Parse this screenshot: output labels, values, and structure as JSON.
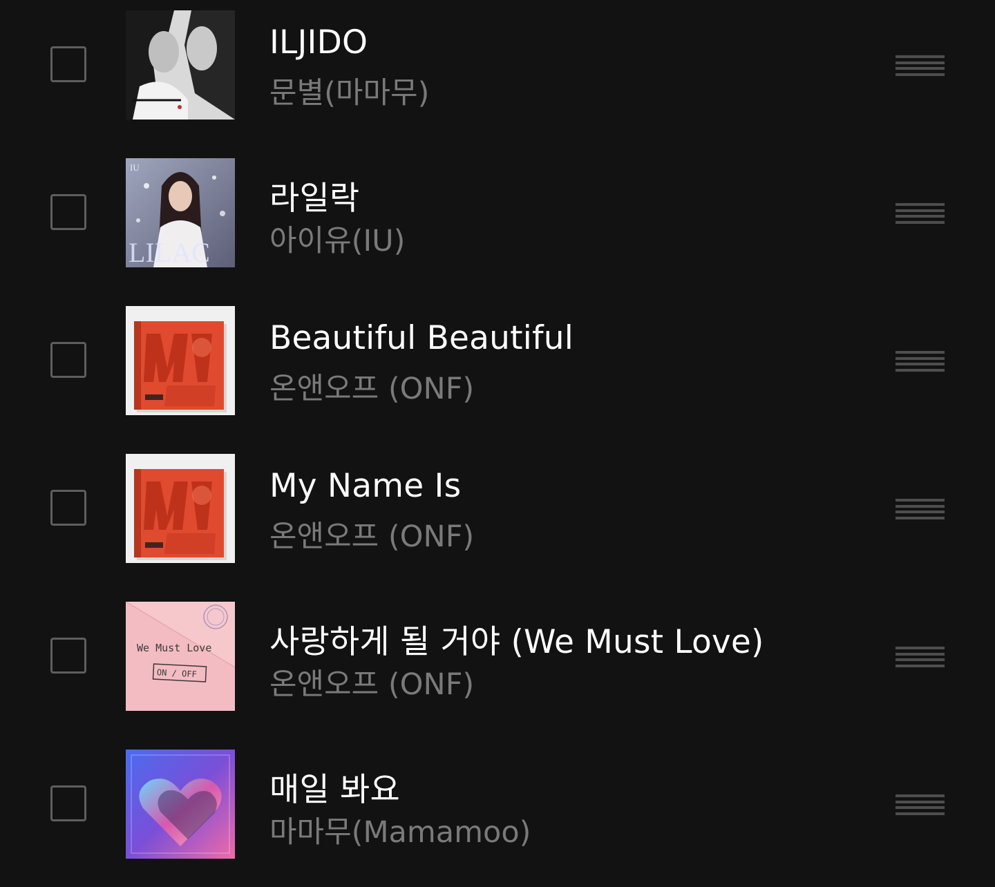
{
  "colors": {
    "background": "#121212",
    "title": "#ffffff",
    "artist": "#7a7a7a",
    "checkbox_border": "#5e5e5e",
    "handle": "#4e4e4e"
  },
  "songs": [
    {
      "title": "ILJIDO",
      "artist": "문별(마마무)",
      "checked": false,
      "art_icon": "album-art-iljido"
    },
    {
      "title": "라일락",
      "artist": "아이유(IU)",
      "checked": false,
      "art_icon": "album-art-lilac"
    },
    {
      "title": "Beautiful Beautiful",
      "artist": "온앤오프 (ONF)",
      "checked": false,
      "art_icon": "album-art-onf-my-name"
    },
    {
      "title": "My Name Is",
      "artist": "온앤오프 (ONF)",
      "checked": false,
      "art_icon": "album-art-onf-my-name"
    },
    {
      "title": "사랑하게 될 거야 (We Must Love)",
      "artist": "온앤오프 (ONF)",
      "checked": false,
      "art_icon": "album-art-we-must-love"
    },
    {
      "title": "매일 봐요",
      "artist": "마마무(Mamamoo)",
      "checked": false,
      "art_icon": "album-art-mamamoo"
    }
  ],
  "art_text": {
    "lilac_letters": "LILAC",
    "lilac_artist": "IU",
    "we_must_love_title": "We Must Love",
    "we_must_love_stamp": "ON / OFF"
  }
}
